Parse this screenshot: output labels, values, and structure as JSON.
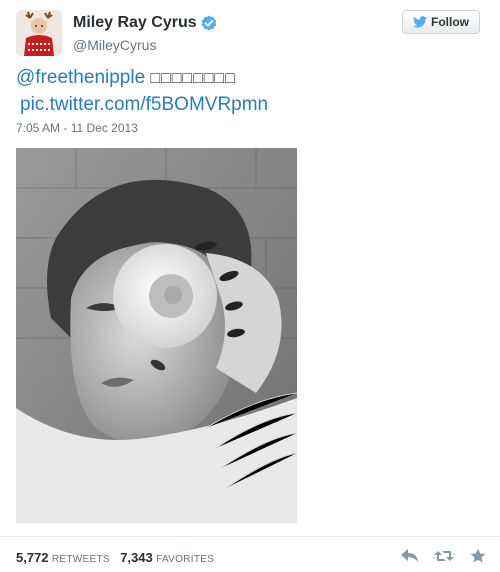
{
  "user": {
    "display_name": "Miley Ray Cyrus",
    "screen_name": "@MileyCyrus",
    "verified": true
  },
  "follow_button": {
    "label": "Follow"
  },
  "tweet": {
    "hashtag": "@freethenipple",
    "unrendered_chars": "□□□□□□□□",
    "link": "pic.twitter.com/f5BOMVRpmn",
    "timestamp": "7:05 AM - 11 Dec 2013"
  },
  "stats": {
    "retweets_count": "5,772",
    "retweets_label": "RETWEETS",
    "favorites_count": "7,343",
    "favorites_label": "FAVORITES"
  },
  "actions": [
    {
      "name": "reply-icon"
    },
    {
      "name": "retweet-icon"
    },
    {
      "name": "favorite-icon"
    }
  ],
  "colors": {
    "link": "#2b7bb9",
    "verified": "#55acee",
    "twitter_bird": "#55acee",
    "muted_text": "#66757f"
  }
}
